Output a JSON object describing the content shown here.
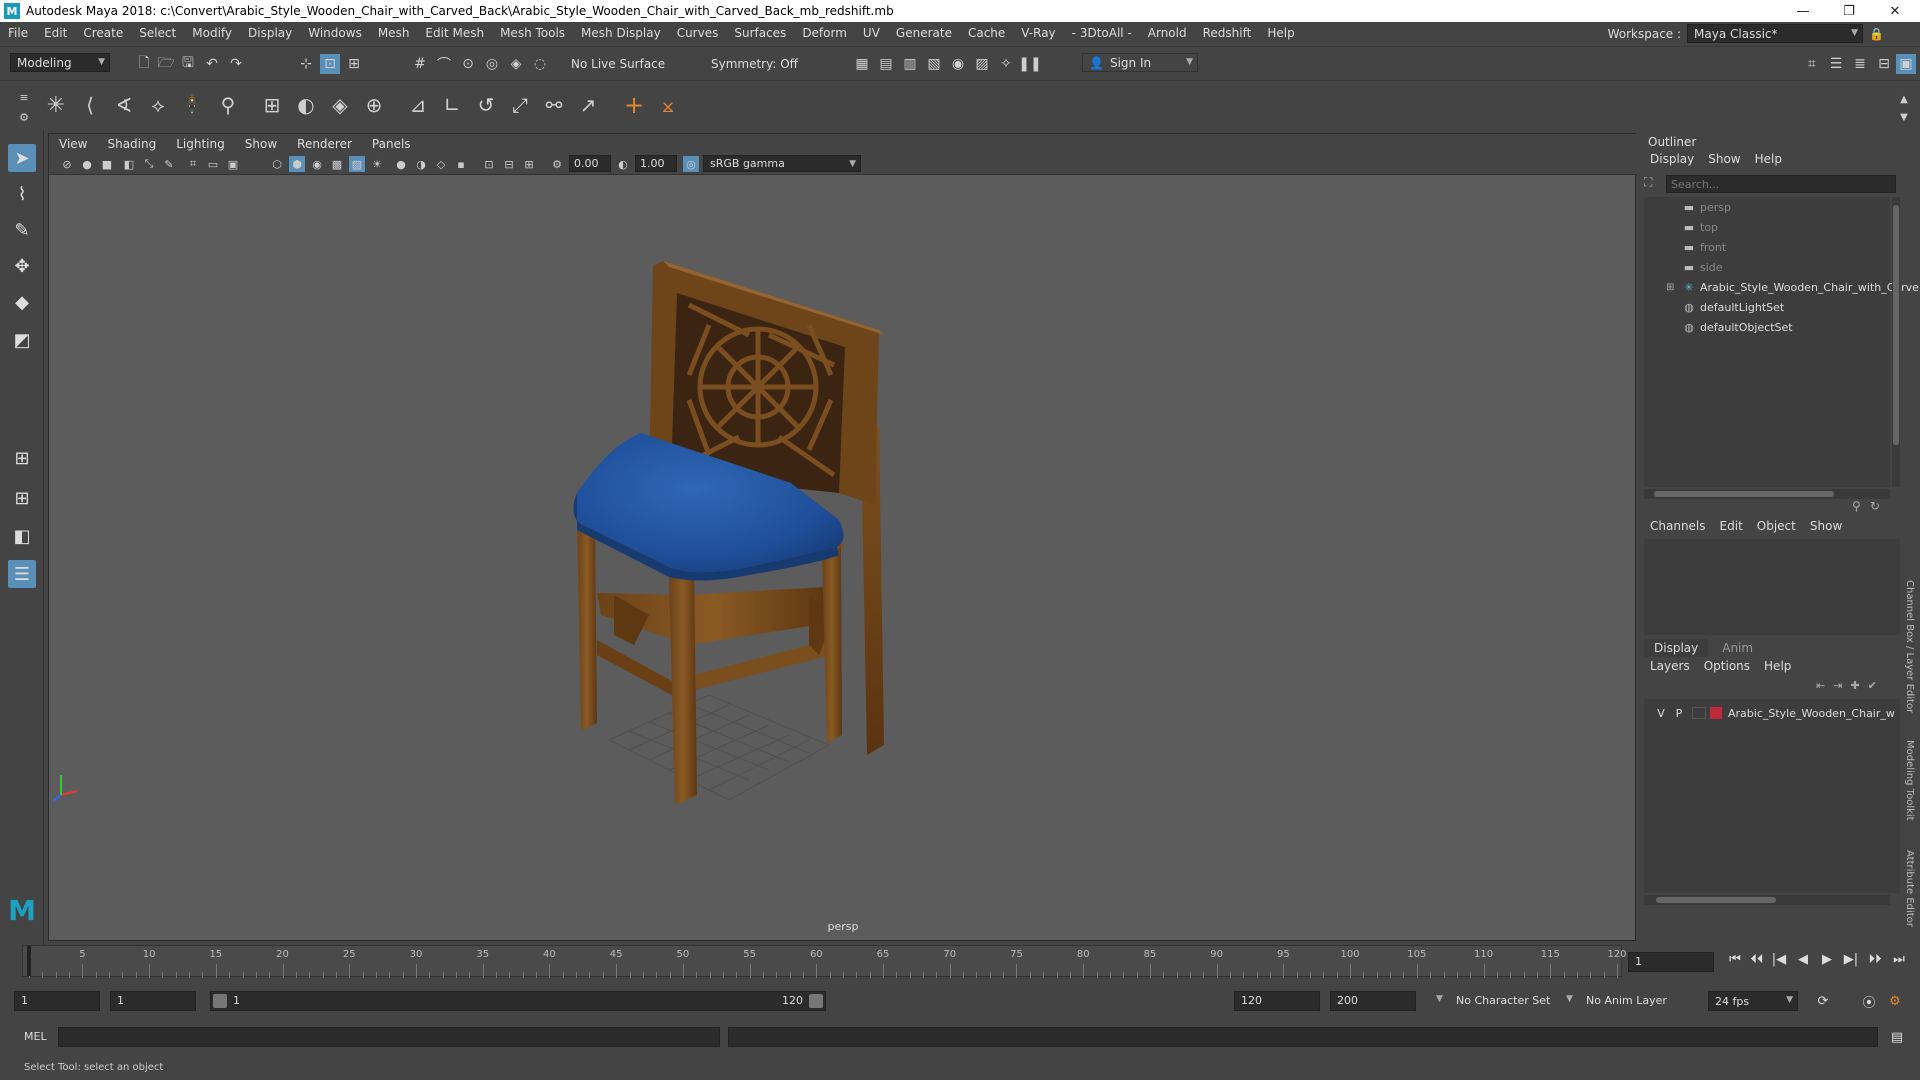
{
  "window": {
    "title": "Autodesk Maya 2018: c:\\Convert\\Arabic_Style_Wooden_Chair_with_Carved_Back\\Arabic_Style_Wooden_Chair_with_Carved_Back_mb_redshift.mb",
    "app_icon": "M"
  },
  "menubar": {
    "items": [
      "File",
      "Edit",
      "Create",
      "Select",
      "Modify",
      "Display",
      "Windows",
      "Mesh",
      "Edit Mesh",
      "Mesh Tools",
      "Mesh Display",
      "Curves",
      "Surfaces",
      "Deform",
      "UV",
      "Generate",
      "Cache",
      "V-Ray",
      "- 3DtoAll -",
      "Arnold",
      "Redshift",
      "Help"
    ],
    "workspace_label": "Workspace :",
    "workspace_value": "Maya Classic*"
  },
  "statusline": {
    "mode": "Modeling",
    "live_surface": "No Live Surface",
    "symmetry": "Symmetry: Off",
    "sign_in": "Sign In"
  },
  "viewport": {
    "menu": [
      "View",
      "Shading",
      "Lighting",
      "Show",
      "Renderer",
      "Panels"
    ],
    "exposure": "0.00",
    "gamma": "1.00",
    "color_space": "sRGB gamma",
    "camera_label": "persp"
  },
  "outliner": {
    "title": "Outliner",
    "menu": [
      "Display",
      "Show",
      "Help"
    ],
    "search_placeholder": "Search...",
    "items": [
      {
        "label": "persp",
        "kind": "camera"
      },
      {
        "label": "top",
        "kind": "camera"
      },
      {
        "label": "front",
        "kind": "camera"
      },
      {
        "label": "side",
        "kind": "camera"
      },
      {
        "label": "Arabic_Style_Wooden_Chair_with_Carve",
        "kind": "group"
      },
      {
        "label": "defaultLightSet",
        "kind": "set"
      },
      {
        "label": "defaultObjectSet",
        "kind": "set"
      }
    ]
  },
  "channelbox": {
    "menu": [
      "Channels",
      "Edit",
      "Object",
      "Show"
    ]
  },
  "layers": {
    "tabs": [
      "Display",
      "Anim"
    ],
    "menu": [
      "Layers",
      "Options",
      "Help"
    ],
    "row": {
      "v": "V",
      "p": "P",
      "name": "Arabic_Style_Wooden_Chair_w",
      "color": "#c0283c"
    }
  },
  "side_tabs": [
    "Channel Box / Layer Editor",
    "Modeling Toolkit",
    "Attribute Editor"
  ],
  "timeline": {
    "ticks": [
      1,
      5,
      10,
      15,
      20,
      25,
      30,
      35,
      40,
      45,
      50,
      55,
      60,
      65,
      70,
      75,
      80,
      85,
      90,
      95,
      100,
      105,
      110,
      115,
      120
    ],
    "current_frame": "1"
  },
  "range": {
    "start": "1",
    "start2": "1",
    "slider_start": "1",
    "slider_end": "120",
    "end": "120",
    "end2": "200",
    "character_set": "No Character Set",
    "anim_layer": "No Anim Layer",
    "fps": "24 fps"
  },
  "cmdline": {
    "lang": "MEL"
  },
  "helpline": {
    "text": "Select Tool: select an object"
  }
}
